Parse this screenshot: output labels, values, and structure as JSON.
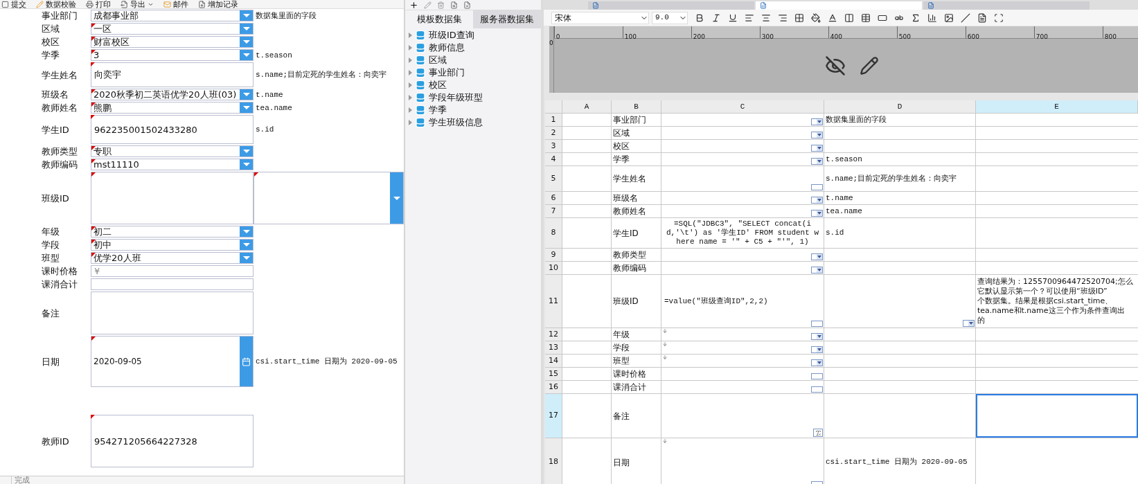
{
  "form_toolbar": [
    {
      "label": "提交",
      "has_menu": false
    },
    {
      "label": "数据校验",
      "has_menu": false
    },
    {
      "label": "打印",
      "has_menu": false
    },
    {
      "label": "导出",
      "has_menu": true
    },
    {
      "label": "邮件",
      "has_menu": false
    },
    {
      "label": "增加记录",
      "has_menu": false
    }
  ],
  "form_fields": [
    {
      "label": "事业部门",
      "kind": "combo",
      "value": "成都事业部",
      "flagged": false,
      "note": "数据集里面的字段"
    },
    {
      "label": "区域",
      "kind": "combo",
      "value": "一区",
      "flagged": true
    },
    {
      "label": "校区",
      "kind": "combo",
      "value": "财富校区",
      "flagged": true
    },
    {
      "label": "学季",
      "kind": "combo",
      "value": "3",
      "flagged": true,
      "note": "t.season"
    },
    {
      "label": "学生姓名",
      "kind": "text",
      "value": "向奕宇",
      "flagged": true,
      "note": "s.name;目前定死的学生姓名：向奕宇"
    },
    {
      "label": "班级名",
      "kind": "combo",
      "value": "2020秋季初二英语优学20人班(03)",
      "flagged": true,
      "note": "t.name"
    },
    {
      "label": "教师姓名",
      "kind": "combo",
      "value": "熊鹏",
      "flagged": true,
      "note": "tea.name"
    },
    {
      "label": "学生ID",
      "kind": "text",
      "value": "962235001502433280",
      "flagged": true,
      "note": "s.id"
    },
    {
      "label": "教师类型",
      "kind": "combo",
      "value": "专职",
      "flagged": true
    },
    {
      "label": "教师编码",
      "kind": "combo",
      "value": "mst11110",
      "flagged": true
    },
    {
      "label": "班级ID",
      "kind": "pair",
      "flagged": true
    },
    {
      "label": "年级",
      "kind": "combo",
      "value": "初二",
      "flagged": true
    },
    {
      "label": "学段",
      "kind": "combo",
      "value": "初中",
      "flagged": true
    },
    {
      "label": "班型",
      "kind": "combo",
      "value": "优学20人班",
      "flagged": true
    },
    {
      "label": "课时价格",
      "kind": "text",
      "placeholder": "¥",
      "flagged": false
    },
    {
      "label": "课消合计",
      "kind": "text",
      "flagged": false
    },
    {
      "label": "备注",
      "kind": "text",
      "flagged": false
    },
    {
      "label": "日期",
      "kind": "date",
      "value": "2020-09-05",
      "flagged": true,
      "note": "csi.start_time 日期为 2020-09-05"
    },
    {
      "label": "教师ID",
      "kind": "text",
      "value": "954271205664227328",
      "flagged": true
    }
  ],
  "status_bar": "完成",
  "dataset_panel": {
    "tabs": [
      {
        "label": "模板数据集",
        "selected": true
      },
      {
        "label": "服务器数据集",
        "selected": false
      }
    ],
    "items": [
      {
        "label": "班级ID查询",
        "expanded": false
      },
      {
        "label": "教师信息",
        "expanded": false
      },
      {
        "label": "区域",
        "expanded": false
      },
      {
        "label": "事业部门",
        "expanded": false
      },
      {
        "label": "校区",
        "expanded": false
      },
      {
        "label": "学段年级班型",
        "expanded": false
      },
      {
        "label": "学季",
        "expanded": false
      },
      {
        "label": "学生班级信息",
        "expanded": false
      }
    ]
  },
  "document_tabs": [
    {
      "selected": false
    },
    {
      "selected": true
    },
    {
      "selected": false
    }
  ],
  "format_toolbar": {
    "font": "宋体",
    "size": "9.0"
  },
  "ruler": {
    "ticks": [
      "0",
      "100",
      "200",
      "300",
      "400",
      "500",
      "600",
      "700",
      "800"
    ],
    "vertical": "0"
  },
  "sheet": {
    "columns": [
      {
        "label": "A",
        "selected": false
      },
      {
        "label": "B",
        "selected": false
      },
      {
        "label": "C",
        "selected": false
      },
      {
        "label": "D",
        "selected": false
      },
      {
        "label": "E",
        "selected": true
      }
    ],
    "rows": [
      {
        "number": "1",
        "selected": false,
        "b": "事业部门",
        "c": {
          "kind": "combo",
          "expand_down": false
        },
        "d": {
          "kind": "plain",
          "text": "数据集里面的字段"
        },
        "e": {
          "active": false
        }
      },
      {
        "number": "2",
        "selected": false,
        "b": "区域",
        "c": {
          "kind": "combo",
          "expand_down": false
        },
        "d": {
          "kind": "plain"
        },
        "e": {
          "active": false
        }
      },
      {
        "number": "3",
        "selected": false,
        "b": "校区",
        "c": {
          "kind": "combo",
          "expand_down": false
        },
        "d": {
          "kind": "plain"
        },
        "e": {
          "active": false
        }
      },
      {
        "number": "4",
        "selected": false,
        "b": "学季",
        "c": {
          "kind": "combo",
          "expand_down": false
        },
        "d": {
          "kind": "plain",
          "text": "t.season"
        },
        "e": {
          "active": false
        }
      },
      {
        "number": "5",
        "selected": false,
        "b": "学生姓名",
        "c": {
          "kind": "text",
          "expand_down": false
        },
        "d": {
          "kind": "plain",
          "text": "s.name;目前定死的学生姓名：向奕宇"
        },
        "e": {
          "active": false
        }
      },
      {
        "number": "6",
        "selected": false,
        "b": "班级名",
        "c": {
          "kind": "combo",
          "expand_down": false
        },
        "d": {
          "kind": "plain",
          "text": "t.name"
        },
        "e": {
          "active": false
        }
      },
      {
        "number": "7",
        "selected": false,
        "b": "教师姓名",
        "c": {
          "kind": "combo",
          "expand_down": false
        },
        "d": {
          "kind": "plain",
          "text": "tea.name"
        },
        "e": {
          "active": false
        }
      },
      {
        "number": "8",
        "selected": false,
        "b": "学生ID",
        "c": {
          "kind": "formula",
          "expand_down": false,
          "formula": "=SQL(\"JDBC3\", \"SELECT concat(id,'\\t') as '学生ID' FROM student where name = '\" + C5 + \"'\", 1)"
        },
        "d": {
          "kind": "plain",
          "text": "s.id"
        },
        "e": {
          "active": false
        }
      },
      {
        "number": "9",
        "selected": false,
        "b": "教师类型",
        "c": {
          "kind": "combo",
          "expand_down": false
        },
        "d": {
          "kind": "plain"
        },
        "e": {
          "active": false
        }
      },
      {
        "number": "10",
        "selected": false,
        "b": "教师编码",
        "c": {
          "kind": "combo",
          "expand_down": false
        },
        "d": {
          "kind": "plain"
        },
        "e": {
          "active": false
        }
      },
      {
        "number": "11",
        "selected": false,
        "b": "班级ID",
        "c": {
          "kind": "text",
          "expand_down": false,
          "formula": "=value(\"班级查询ID\",2,2)"
        },
        "d": {
          "kind": "combo"
        },
        "e": {
          "active": false,
          "lines": [
            "查询结果为：1255700964472520704;怎么",
            "它默认显示第一个？可以使用“班级ID”",
            "个数据集。结果是根据csi.start_time、",
            "tea.name和t.name这三个作为条件查询出",
            "的"
          ]
        }
      },
      {
        "number": "12",
        "selected": false,
        "b": "年级",
        "c": {
          "kind": "combo",
          "expand_down": true
        },
        "d": {
          "kind": "plain"
        },
        "e": {
          "active": false
        }
      },
      {
        "number": "13",
        "selected": false,
        "b": "学段",
        "c": {
          "kind": "combo",
          "expand_down": true
        },
        "d": {
          "kind": "plain"
        },
        "e": {
          "active": false
        }
      },
      {
        "number": "14",
        "selected": false,
        "b": "班型",
        "c": {
          "kind": "combo",
          "expand_down": true
        },
        "d": {
          "kind": "plain"
        },
        "e": {
          "active": false
        }
      },
      {
        "number": "15",
        "selected": false,
        "b": "课时价格",
        "c": {
          "kind": "text",
          "expand_down": false
        },
        "d": {
          "kind": "plain"
        },
        "e": {
          "active": false
        }
      },
      {
        "number": "16",
        "selected": false,
        "b": "课消合计",
        "c": {
          "kind": "text",
          "expand_down": false
        },
        "d": {
          "kind": "plain"
        },
        "e": {
          "active": false
        }
      },
      {
        "number": "17",
        "selected": true,
        "b": "备注",
        "c": {
          "kind": "memo",
          "expand_down": false
        },
        "d": {
          "kind": "plain"
        },
        "e": {
          "active": true
        }
      },
      {
        "number": "18",
        "selected": false,
        "b": "日期",
        "c": {
          "kind": "date",
          "expand_down": true
        },
        "d": {
          "kind": "plain",
          "text": "csi.start_time 日期为 2020-09-05"
        },
        "e": {
          "active": false
        }
      }
    ]
  }
}
